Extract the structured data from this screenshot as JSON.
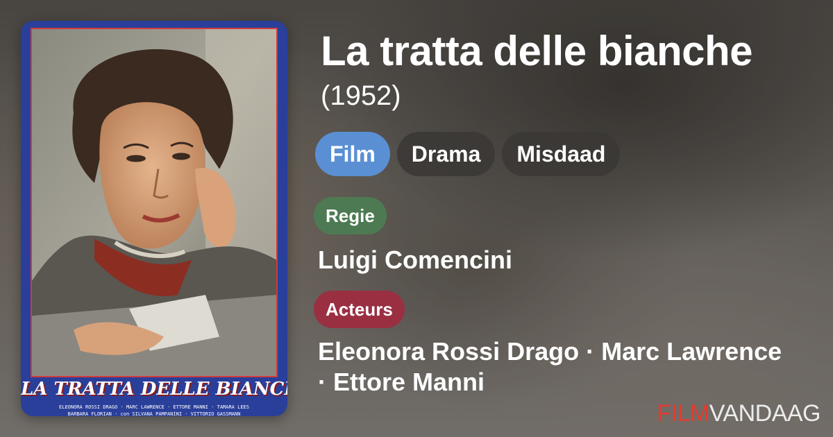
{
  "movie": {
    "title": "La tratta delle bianche",
    "year": "(1952)"
  },
  "genres": [
    "Film",
    "Drama",
    "Misdaad"
  ],
  "director": {
    "label": "Regie",
    "name": "Luigi Comencini"
  },
  "cast": {
    "label": "Acteurs",
    "line1": "Eleonora Rossi Drago · Marc Lawrence",
    "line2": "· Ettore Manni"
  },
  "poster": {
    "title": "LA TRATTA DELLE BIANCHE",
    "credits_line1": "ELEONORA ROSSI DRAGO · MARC LAWRENCE · ETTORE MANNI · TAMARA LEES",
    "credits_line2": "BARBARA FLORIAN · con SILVANA PAMPANINI · VITTORIO GASSMANN"
  },
  "brand": {
    "part1": "FILM",
    "part2": "VANDAAG"
  },
  "colors": {
    "film_chip": "#5b8fd3",
    "genre_chip": "#3a3836",
    "regie_badge": "#4d7a52",
    "acteurs_badge": "#9a2f42",
    "logo_red": "#e23b30",
    "poster_border_blue": "#2a3f9a"
  }
}
